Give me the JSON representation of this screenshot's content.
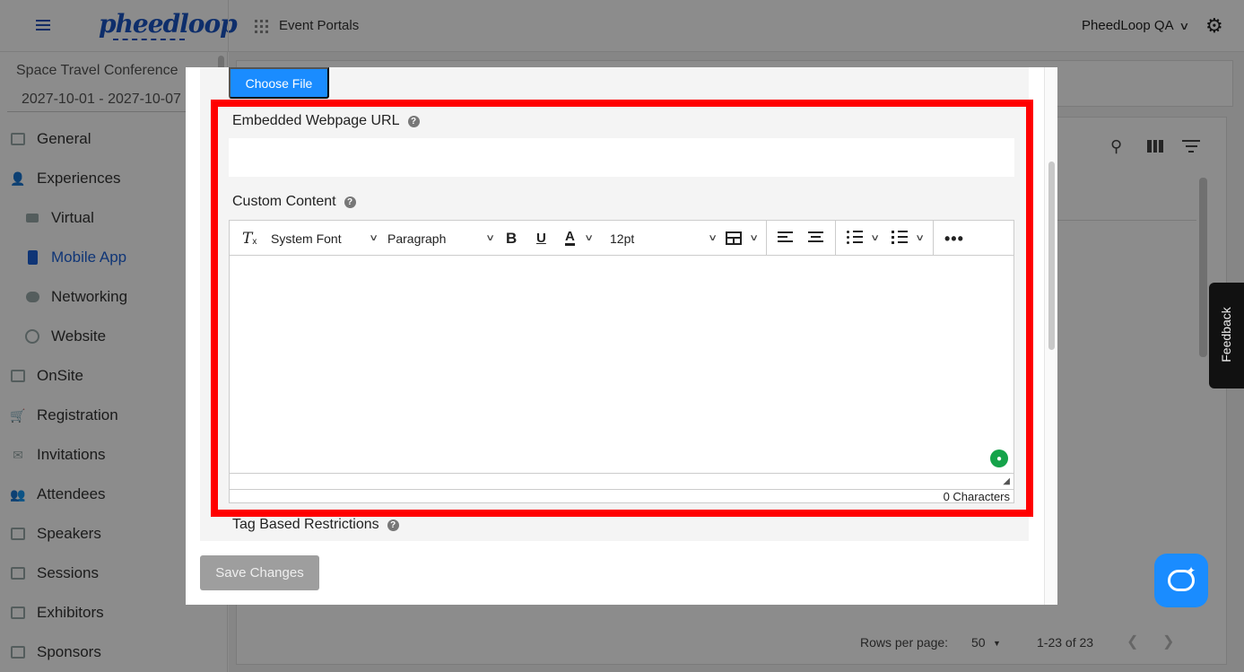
{
  "topbar": {
    "brand": "pheedloop",
    "nav_label": "Event Portals",
    "org_name": "PheedLoop QA"
  },
  "sidebar": {
    "event_name": "Space Travel Conference",
    "event_dates": "2027-10-01 - 2027-10-07",
    "items": [
      {
        "label": "General",
        "icon": "grid-icon"
      },
      {
        "label": "Experiences",
        "icon": "person-icon"
      },
      {
        "label": "Virtual",
        "icon": "video-icon"
      },
      {
        "label": "Mobile App",
        "icon": "phone-icon",
        "active": true
      },
      {
        "label": "Networking",
        "icon": "chat-bubble-icon"
      },
      {
        "label": "Website",
        "icon": "globe-icon"
      },
      {
        "label": "OnSite",
        "icon": "printer-icon"
      },
      {
        "label": "Registration",
        "icon": "cart-icon"
      },
      {
        "label": "Invitations",
        "icon": "mail-icon"
      },
      {
        "label": "Attendees",
        "icon": "people-icon"
      },
      {
        "label": "Speakers",
        "icon": "speaker-icon"
      },
      {
        "label": "Sessions",
        "icon": "laptop-icon"
      },
      {
        "label": "Exhibitors",
        "icon": "store-icon"
      },
      {
        "label": "Sponsors",
        "icon": "handshake-icon"
      }
    ]
  },
  "background_table": {
    "rows_per_page_label": "Rows per page:",
    "rows_per_page_value": "50",
    "range": "1-23 of 23"
  },
  "modal": {
    "choose_file_label": "Choose File",
    "embedded_url": {
      "label": "Embedded Webpage URL",
      "value": "",
      "help": "?"
    },
    "custom_content": {
      "label": "Custom Content",
      "help": "?",
      "toolbar": {
        "clear_format": "T",
        "font_family": "System Font",
        "block_format": "Paragraph",
        "bold": "B",
        "underline": "U",
        "text_color": "A",
        "font_size": "12pt",
        "more": "•••"
      },
      "char_count": "0 Characters"
    },
    "tag_restrictions": {
      "label": "Tag Based Restrictions",
      "help": "?"
    },
    "save_label": "Save Changes"
  },
  "widgets": {
    "feedback_label": "Feedback"
  },
  "colors": {
    "accent": "#1a8cff",
    "active_nav": "#1d62d8",
    "highlight": "#ff0000"
  }
}
